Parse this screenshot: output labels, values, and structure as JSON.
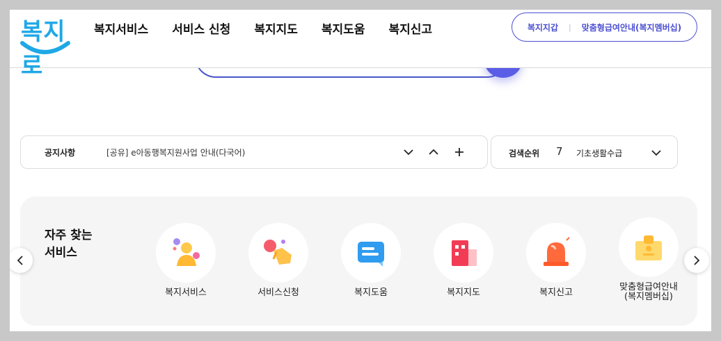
{
  "logo": {
    "text": "복지로"
  },
  "nav": {
    "items": [
      "복지서비스",
      "서비스 신청",
      "복지지도",
      "복지도움",
      "복지신고"
    ]
  },
  "quick_links": {
    "left": "복지지갑",
    "right": "맞춤형급여안내(복지멤버십)"
  },
  "notice": {
    "label": "공지사항",
    "text": "[공유] e아동행복지원사업 안내(다국어)"
  },
  "rank": {
    "label": "검색순위",
    "number": "7",
    "term": "기초생활수급"
  },
  "services": {
    "title_line1": "자주 찾는",
    "title_line2": "서비스",
    "items": [
      {
        "label": "복지서비스",
        "icon": "person-icon"
      },
      {
        "label": "서비스신청",
        "icon": "hand-click-icon"
      },
      {
        "label": "복지도움",
        "icon": "chat-icon"
      },
      {
        "label": "복지지도",
        "icon": "building-icon"
      },
      {
        "label": "복지신고",
        "icon": "siren-icon"
      },
      {
        "label_line1": "맞춤형급여안내",
        "label_line2": "(복지멤버십)",
        "icon": "id-card-icon"
      }
    ]
  },
  "colors": {
    "brand": "#1fa8e6",
    "accent": "#4b4fd1",
    "panel": "#f5f5f5"
  }
}
